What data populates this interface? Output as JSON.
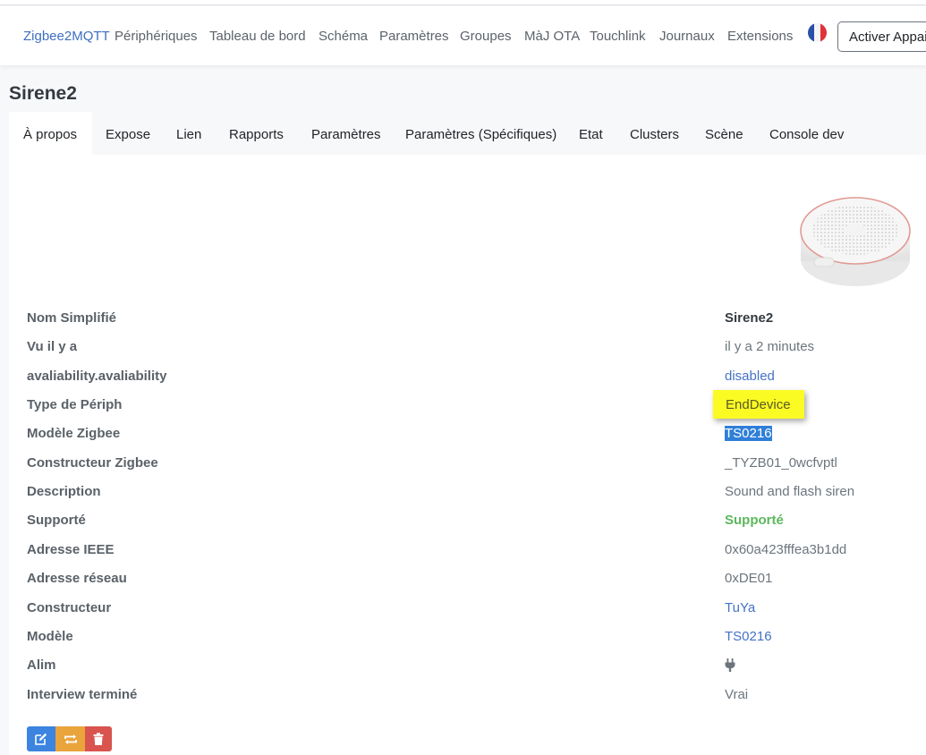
{
  "nav": {
    "brand": "Zigbee2MQTT",
    "items": [
      "Périphériques",
      "Tableau de bord",
      "Schéma",
      "Paramètres",
      "Groupes",
      "MàJ OTA",
      "Touchlink",
      "Journaux",
      "Extensions"
    ],
    "ota_button": "Activer Appairage",
    "flag_icon": "france-flag-icon"
  },
  "device": {
    "title": "Sirene2"
  },
  "tabs": [
    "À propos",
    "Expose",
    "Lien",
    "Rapports",
    "Paramètres",
    "Paramètres (Spécifiques)",
    "Etat",
    "Clusters",
    "Scène",
    "Console dev"
  ],
  "active_tab": "À propos",
  "details": [
    {
      "label": "Nom Simplifié",
      "value": "Sirene2"
    },
    {
      "label": "Vu il y a",
      "value": "il y a 2 minutes"
    },
    {
      "label": "avaliability.avaliability",
      "value": "disabled"
    },
    {
      "label": "Type de Périph",
      "value": "EndDevice"
    },
    {
      "label": "Modèle Zigbee",
      "value": "TS0216"
    },
    {
      "label": "Constructeur Zigbee",
      "value": "_TYZB01_0wcfvptl"
    },
    {
      "label": "Description",
      "value": "Sound and flash siren"
    },
    {
      "label": "Supporté",
      "value": "Supporté"
    },
    {
      "label": "Adresse IEEE",
      "value": "0x60a423fffea3b1dd"
    },
    {
      "label": "Adresse réseau",
      "value": "0xDE01"
    },
    {
      "label": "Constructeur",
      "value": "TuYa"
    },
    {
      "label": "Modèle",
      "value": "TS0216"
    },
    {
      "label": "Alim",
      "value_icon": "plug-icon"
    },
    {
      "label": "Interview terminé",
      "value": "Vrai"
    }
  ],
  "actions": {
    "edit_icon": "edit-icon",
    "reconfigure_icon": "reconfigure-icon",
    "delete_icon": "trash-icon"
  },
  "colors": {
    "brand": "#3d6fbf",
    "link": "#4472c4",
    "supported": "#5cb85c",
    "highlight": "#fbfb24",
    "selection": "#2f7fd8",
    "edit_button": "#3b84e0",
    "reconfigure_button": "#e9a43c",
    "delete_button": "#d9534f"
  }
}
